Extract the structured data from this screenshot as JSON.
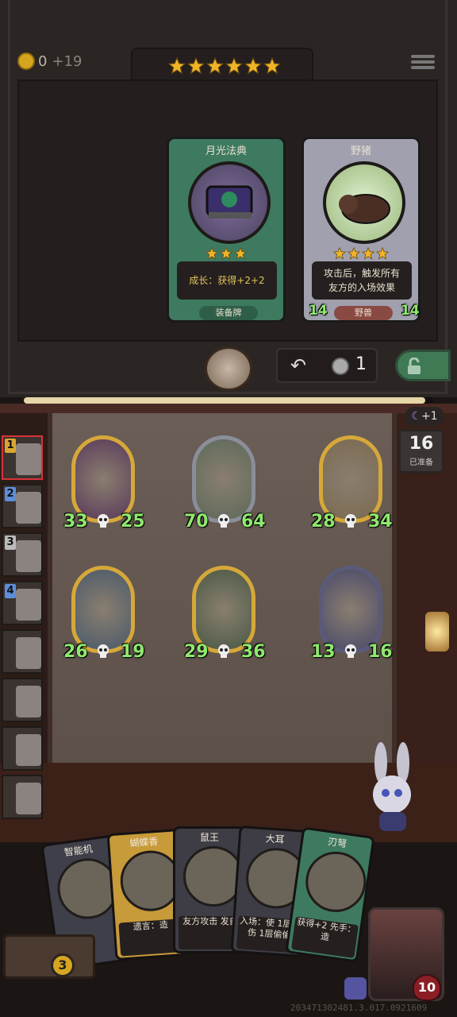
{
  "header": {
    "gold": "0",
    "gold_income": "+19",
    "tier_stars": 6
  },
  "shop": {
    "cards": [
      {
        "title": "月光法典",
        "stars": 3,
        "desc_lines": [
          "成长：获得+2+2"
        ],
        "type": "装备牌",
        "color": "#3e7a60",
        "atk": "",
        "hp": ""
      },
      {
        "title": "野猪",
        "stars": 4,
        "desc_lines": [
          "攻击后，触发所有",
          "友方的入场效果"
        ],
        "type": "野兽",
        "color": "#a0a0ae",
        "atk": "14",
        "hp": "14"
      }
    ]
  },
  "controls": {
    "refresh_cost": "1"
  },
  "board": {
    "turn_bonus": "+1",
    "ready_count": "16",
    "ready_label": "已准备",
    "minions": [
      {
        "atk": "33",
        "hp": "25",
        "frame": "#d6a83a",
        "bg": "#5a3a5a"
      },
      {
        "atk": "70",
        "hp": "64",
        "frame": "#8a8e9a",
        "bg": "#5d6a5a"
      },
      {
        "atk": "28",
        "hp": "34",
        "frame": "#d6a83a",
        "bg": "#7a6a50"
      },
      {
        "atk": "26",
        "hp": "19",
        "frame": "#d6a83a",
        "bg": "#4a5a6a"
      },
      {
        "atk": "29",
        "hp": "36",
        "frame": "#d6a83a",
        "bg": "#4a5a44"
      },
      {
        "atk": "13",
        "hp": "16",
        "frame": "#5a5a7a",
        "bg": "#4a4a6a"
      }
    ]
  },
  "sidebar": {
    "slots": [
      {
        "num": "1",
        "numcolor": "#d9a730"
      },
      {
        "num": "2",
        "numcolor": "#5e8ed8"
      },
      {
        "num": "3",
        "numcolor": "#bbbbbb"
      },
      {
        "num": "4",
        "numcolor": "#5e8ed8"
      },
      {
        "num": "",
        "numcolor": ""
      },
      {
        "num": "",
        "numcolor": ""
      },
      {
        "num": "",
        "numcolor": ""
      },
      {
        "num": "",
        "numcolor": ""
      }
    ]
  },
  "hand": {
    "cards": [
      {
        "title": "智能机",
        "desc": ""
      },
      {
        "title": "蝴蝶香",
        "desc": "遗言：造"
      },
      {
        "title": "鼠王",
        "desc": "友方攻击 发自"
      },
      {
        "title": "大耳",
        "desc": "入场：使 1层增伤 1层偷偷"
      },
      {
        "title": "刃弩",
        "desc": "获得+2 先手：造"
      }
    ]
  },
  "player": {
    "gold_slot": "3",
    "health": "10"
  },
  "footer": {
    "build_id": "203471302481.3.017.0921609"
  }
}
